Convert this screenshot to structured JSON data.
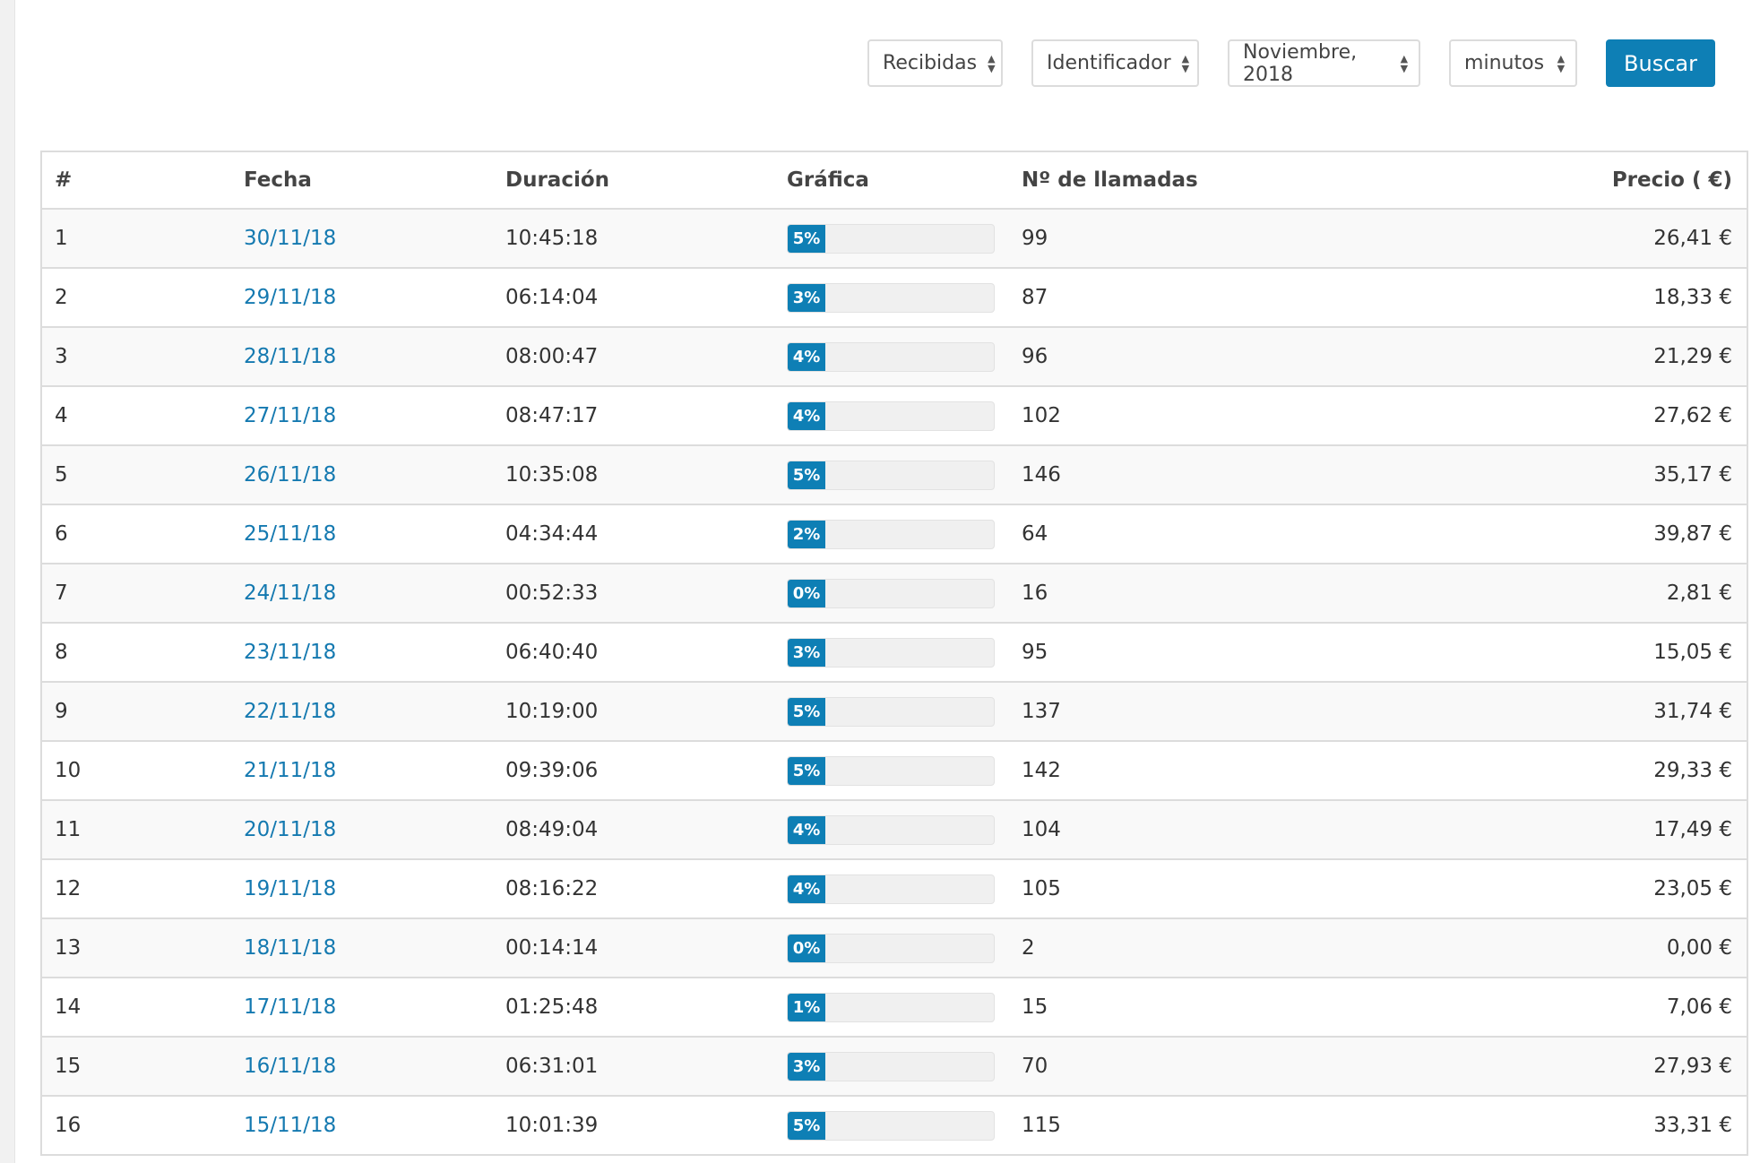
{
  "filters": {
    "type_select": "Recibidas",
    "group_select": "Identificador",
    "month_select": "Noviembre, 2018",
    "unit_select": "minutos",
    "search_button": "Buscar"
  },
  "table": {
    "headers": [
      "#",
      "Fecha",
      "Duración",
      "Gráfica",
      "Nº de llamadas",
      "Precio ( €)"
    ],
    "rows": [
      {
        "n": "1",
        "fecha": "30/11/18",
        "duracion": "10:45:18",
        "pct": "5%",
        "llamadas": "99",
        "precio": "26,41 €"
      },
      {
        "n": "2",
        "fecha": "29/11/18",
        "duracion": "06:14:04",
        "pct": "3%",
        "llamadas": "87",
        "precio": "18,33 €"
      },
      {
        "n": "3",
        "fecha": "28/11/18",
        "duracion": "08:00:47",
        "pct": "4%",
        "llamadas": "96",
        "precio": "21,29 €"
      },
      {
        "n": "4",
        "fecha": "27/11/18",
        "duracion": "08:47:17",
        "pct": "4%",
        "llamadas": "102",
        "precio": "27,62 €"
      },
      {
        "n": "5",
        "fecha": "26/11/18",
        "duracion": "10:35:08",
        "pct": "5%",
        "llamadas": "146",
        "precio": "35,17 €"
      },
      {
        "n": "6",
        "fecha": "25/11/18",
        "duracion": "04:34:44",
        "pct": "2%",
        "llamadas": "64",
        "precio": "39,87 €"
      },
      {
        "n": "7",
        "fecha": "24/11/18",
        "duracion": "00:52:33",
        "pct": "0%",
        "llamadas": "16",
        "precio": "2,81 €"
      },
      {
        "n": "8",
        "fecha": "23/11/18",
        "duracion": "06:40:40",
        "pct": "3%",
        "llamadas": "95",
        "precio": "15,05 €"
      },
      {
        "n": "9",
        "fecha": "22/11/18",
        "duracion": "10:19:00",
        "pct": "5%",
        "llamadas": "137",
        "precio": "31,74 €"
      },
      {
        "n": "10",
        "fecha": "21/11/18",
        "duracion": "09:39:06",
        "pct": "5%",
        "llamadas": "142",
        "precio": "29,33 €"
      },
      {
        "n": "11",
        "fecha": "20/11/18",
        "duracion": "08:49:04",
        "pct": "4%",
        "llamadas": "104",
        "precio": "17,49 €"
      },
      {
        "n": "12",
        "fecha": "19/11/18",
        "duracion": "08:16:22",
        "pct": "4%",
        "llamadas": "105",
        "precio": "23,05 €"
      },
      {
        "n": "13",
        "fecha": "18/11/18",
        "duracion": "00:14:14",
        "pct": "0%",
        "llamadas": "2",
        "precio": "0,00 €"
      },
      {
        "n": "14",
        "fecha": "17/11/18",
        "duracion": "01:25:48",
        "pct": "1%",
        "llamadas": "15",
        "precio": "7,06 €"
      },
      {
        "n": "15",
        "fecha": "16/11/18",
        "duracion": "06:31:01",
        "pct": "3%",
        "llamadas": "70",
        "precio": "27,93 €"
      },
      {
        "n": "16",
        "fecha": "15/11/18",
        "duracion": "10:01:39",
        "pct": "5%",
        "llamadas": "115",
        "precio": "33,31 €"
      }
    ]
  },
  "colors": {
    "accent": "#0e7fb5",
    "link": "#1479b0"
  }
}
